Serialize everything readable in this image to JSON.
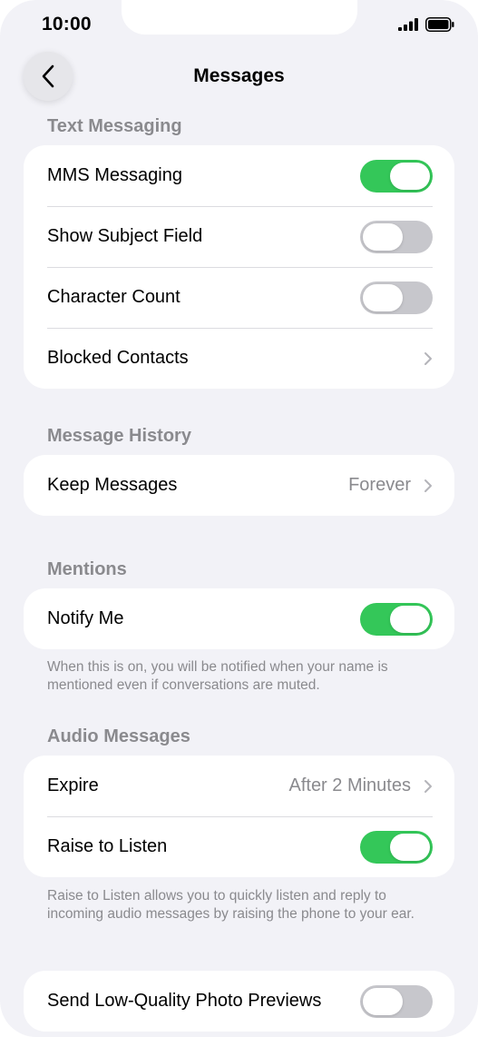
{
  "status_bar": {
    "time": "10:00"
  },
  "nav": {
    "title": "Messages"
  },
  "sections": {
    "text_messaging": {
      "header": "Text Messaging",
      "mms": {
        "label": "MMS Messaging",
        "on": true
      },
      "subject": {
        "label": "Show Subject Field",
        "on": false
      },
      "char_count": {
        "label": "Character Count",
        "on": false
      },
      "blocked": {
        "label": "Blocked Contacts"
      }
    },
    "message_history": {
      "header": "Message History",
      "keep": {
        "label": "Keep Messages",
        "value": "Forever"
      }
    },
    "mentions": {
      "header": "Mentions",
      "notify": {
        "label": "Notify Me",
        "on": true
      },
      "footnote": "When this is on, you will be notified when your name is mentioned even if conversations are muted."
    },
    "audio_messages": {
      "header": "Audio Messages",
      "expire": {
        "label": "Expire",
        "value": "After 2 Minutes"
      },
      "raise": {
        "label": "Raise to Listen",
        "on": true
      },
      "footnote": "Raise to Listen allows you to quickly listen and reply to incoming audio messages by raising the phone to your ear."
    },
    "low_quality": {
      "label": "Send Low-Quality Photo Previews",
      "on": false
    }
  },
  "colors": {
    "toggle_on": "#34c759",
    "toggle_off": "#c7c7cc",
    "background": "#f2f2f7",
    "secondary_text": "#8a8a8e"
  },
  "icons": {
    "back": "chevron-left-icon",
    "chevron": "chevron-right-icon",
    "signal": "cellular-signal-icon",
    "battery": "battery-icon"
  }
}
